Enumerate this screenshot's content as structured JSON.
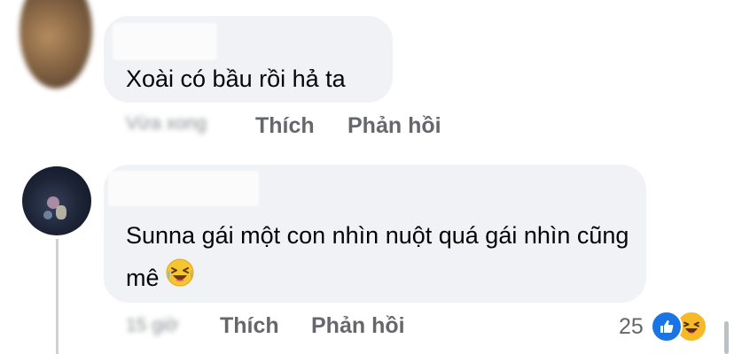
{
  "comments": [
    {
      "text": "Xoài có bầu rồi hả ta",
      "time": "Vừa xong",
      "actions": {
        "like": "Thích",
        "reply": "Phản hồi"
      }
    },
    {
      "text": "Sunna gái một con nhìn nuột quá gái nhìn cũng mê",
      "emoji": "haha-emoji",
      "time": "15 giờ",
      "actions": {
        "like": "Thích",
        "reply": "Phản hồi"
      },
      "reactions": {
        "count": "25",
        "types": [
          "like-icon",
          "haha-icon"
        ]
      }
    }
  ],
  "colors": {
    "bubble": "#f0f2f5",
    "meta_text": "#65676b",
    "like_blue": "#1b74e4",
    "haha_yellow": "#f7b928"
  }
}
